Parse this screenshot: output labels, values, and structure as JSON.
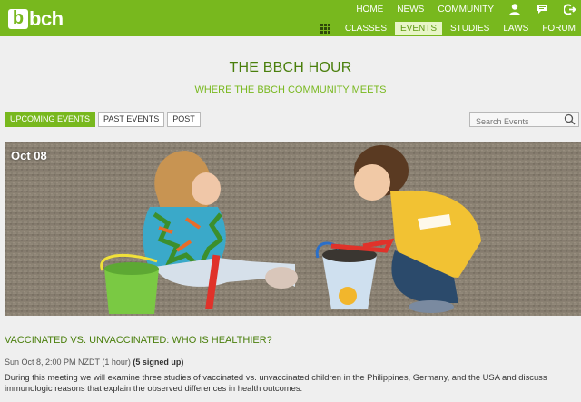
{
  "brand": {
    "logo_text": "bbch",
    "color": "#78b81e"
  },
  "nav_top": {
    "items": [
      "HOME",
      "NEWS",
      "COMMUNITY"
    ],
    "icons": [
      "user-icon",
      "message-icon",
      "logout-icon"
    ]
  },
  "nav_sub": {
    "items": [
      "CLASSES",
      "EVENTS",
      "STUDIES",
      "LAWS",
      "FORUM"
    ],
    "active": "EVENTS"
  },
  "page": {
    "title": "THE BBCH HOUR",
    "subtitle": "WHERE THE BBCH COMMUNITY MEETS"
  },
  "tabs": [
    "UPCOMING EVENTS",
    "PAST EVENTS",
    "POST"
  ],
  "search": {
    "placeholder": "Search Events"
  },
  "event": {
    "date_badge": "Oct 08",
    "title": "VACCINATED VS. UNVACCINATED: WHO IS HEALTHIER?",
    "when": "Sun Oct 8,  2:00 PM NZDT",
    "duration": "(1 hour)",
    "signed_up": "(5 signed up)",
    "description": "During this meeting we will examine three studies of vaccinated vs. unvaccinated children in the Philippines, Germany, and the USA and discuss immunologic reasons that explain the observed differences in health outcomes."
  }
}
